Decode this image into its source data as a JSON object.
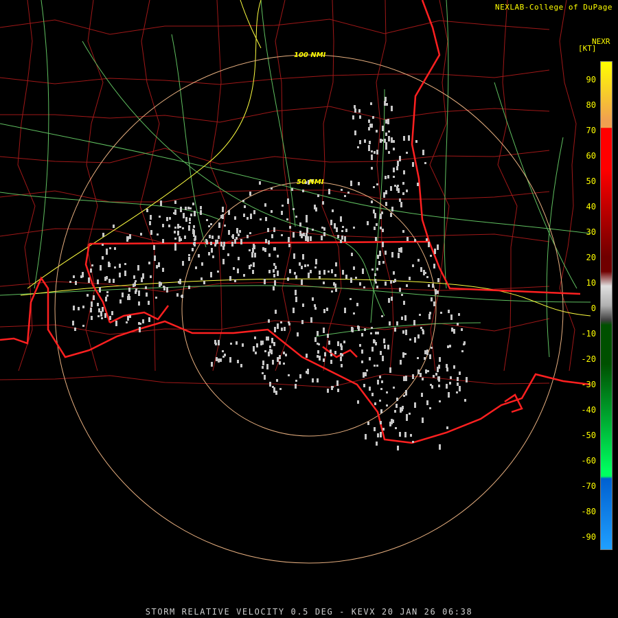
{
  "header": {
    "credit": "NEXLAB-College of DuPage",
    "product": "NEXR",
    "units": "[KT]"
  },
  "range_rings": [
    {
      "label": "100 NMI"
    },
    {
      "label": "50 NMI"
    }
  ],
  "legend": {
    "ticks": [
      "90",
      "80",
      "70",
      "60",
      "50",
      "40",
      "30",
      "20",
      "10",
      "0",
      "-10",
      "-20",
      "-30",
      "-40",
      "-50",
      "-60",
      "-70",
      "-80",
      "-90"
    ],
    "colors": {
      "high": "#ffff00",
      "orange": "#f0a050",
      "red": "#ff0000",
      "dark_red": "#700000",
      "zero_gray": "#b0b0b0",
      "dark_green": "#005000",
      "green": "#00ff60",
      "blue": "#0060d0",
      "light_blue": "#20a0ff"
    }
  },
  "map_colors": {
    "state_border": "#ff2020",
    "county_border": "#a01818",
    "highway": "#ffff40",
    "road": "#60c060",
    "ring": "#e8b080",
    "echo": "#c8c8c8"
  },
  "footer": {
    "caption": "STORM RELATIVE VELOCITY 0.5 DEG - KEVX 20 JAN 26 06:38"
  }
}
